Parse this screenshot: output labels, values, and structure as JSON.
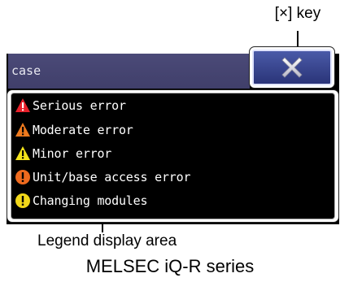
{
  "callouts": {
    "key_label": "[×] key",
    "legend_label": "Legend display area",
    "series_label": "MELSEC iQ-R series"
  },
  "window": {
    "title": "case"
  },
  "legend": {
    "items": [
      {
        "label": "Serious error",
        "icon": "serious-error-icon",
        "color": "#e8202a"
      },
      {
        "label": "Moderate error",
        "icon": "moderate-error-icon",
        "color": "#ee7a1e"
      },
      {
        "label": "Minor error",
        "icon": "minor-error-icon",
        "color": "#f2e21a"
      },
      {
        "label": "Unit/base access error",
        "icon": "unit-base-access-error-icon",
        "color": "#ee6a1e"
      },
      {
        "label": "Changing modules",
        "icon": "changing-modules-icon",
        "color": "#f2d81a"
      }
    ]
  },
  "colors": {
    "title_bar": "#45446f",
    "close_button": "#34408c",
    "legend_background": "#000000"
  }
}
